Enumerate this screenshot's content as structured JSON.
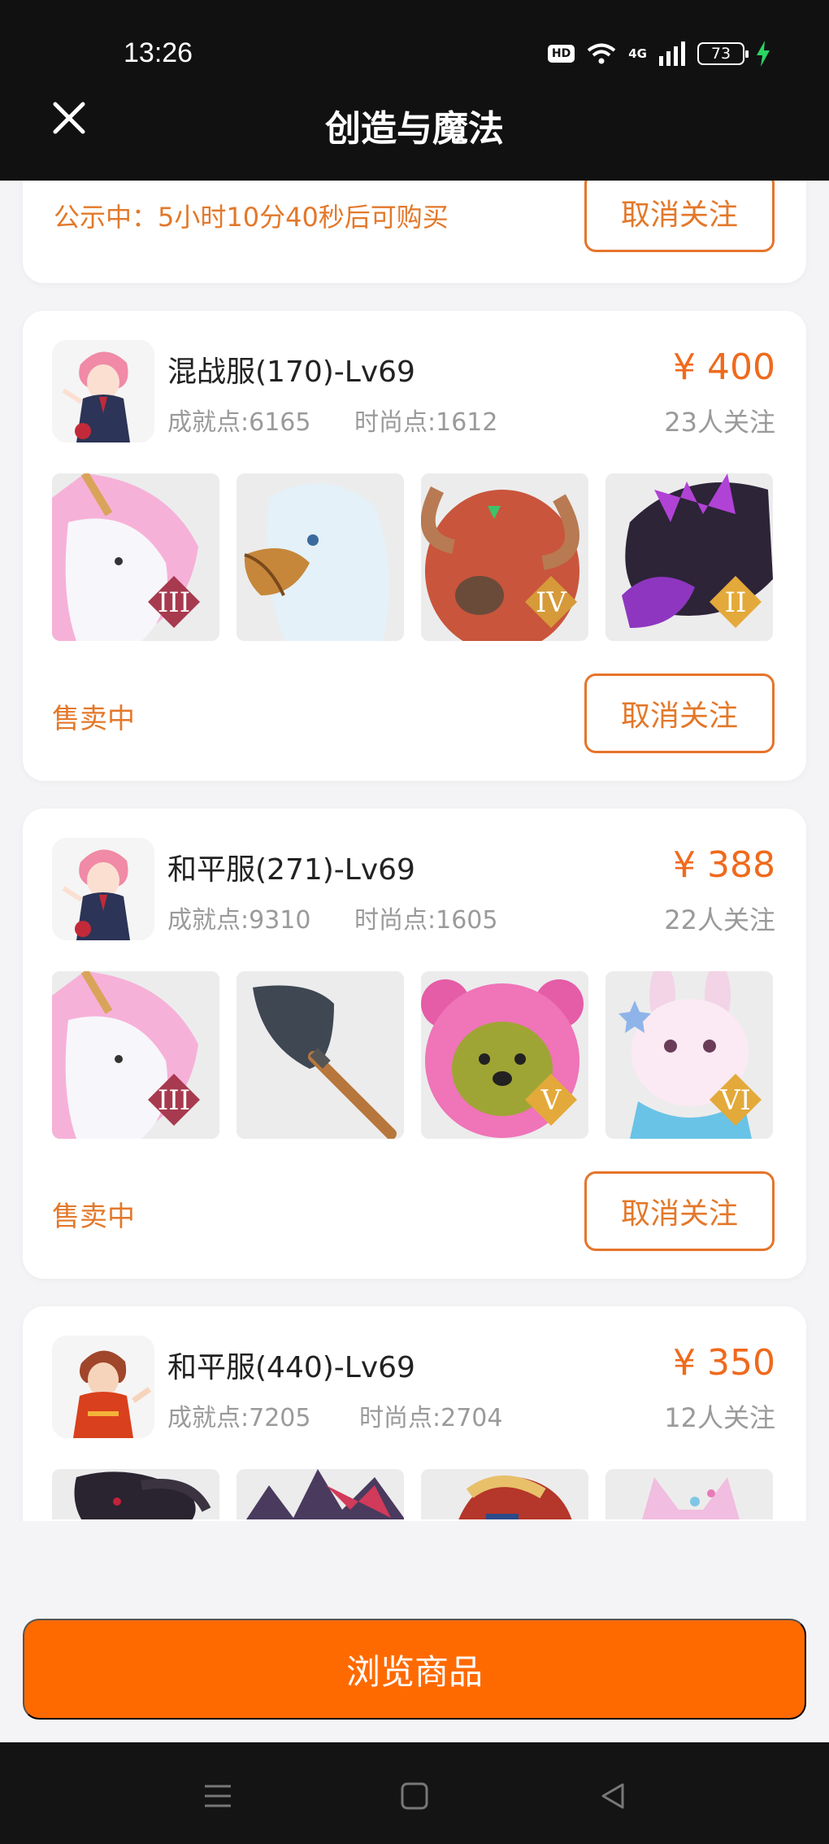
{
  "status_bar": {
    "time": "13:26",
    "hd_badge": "HD",
    "network": "4G",
    "battery": "73"
  },
  "header": {
    "title": "创造与魔法",
    "close_icon": "close-icon"
  },
  "listings": [
    {
      "publicity_text": "公示中：5小时10分40秒后可购买",
      "unfollow_label": "取消关注"
    },
    {
      "server": "混战服(170)-Lv69",
      "achievement": "成就点:6165",
      "fashion": "时尚点:1612",
      "price": "¥ 400",
      "followers": "23人关注",
      "pets": [
        {
          "name": "unicorn",
          "badge": "III"
        },
        {
          "name": "white-griffin",
          "badge": ""
        },
        {
          "name": "red-ram-beast",
          "badge": "IV"
        },
        {
          "name": "purple-dragon",
          "badge": "II"
        }
      ],
      "sale_status": "售卖中",
      "unfollow_label": "取消关注"
    },
    {
      "server": "和平服(271)-Lv69",
      "achievement": "成就点:9310",
      "fashion": "时尚点:1605",
      "price": "¥ 388",
      "followers": "22人关注",
      "pets": [
        {
          "name": "unicorn",
          "badge": "III"
        },
        {
          "name": "shovel",
          "badge": ""
        },
        {
          "name": "pink-bear",
          "badge": "V"
        },
        {
          "name": "bunny",
          "badge": "VI"
        }
      ],
      "sale_status": "售卖中",
      "unfollow_label": "取消关注"
    },
    {
      "server": "和平服(440)-Lv69",
      "achievement": "成就点:7205",
      "fashion": "时尚点:2704",
      "price": "¥ 350",
      "followers": "12人关注"
    }
  ],
  "footer": {
    "browse_label": "浏览商品"
  },
  "colors": {
    "accent_orange": "#ff6a00",
    "text_orange": "#e3782a",
    "price_orange": "#ef6a1d",
    "header_bg": "#111111"
  }
}
